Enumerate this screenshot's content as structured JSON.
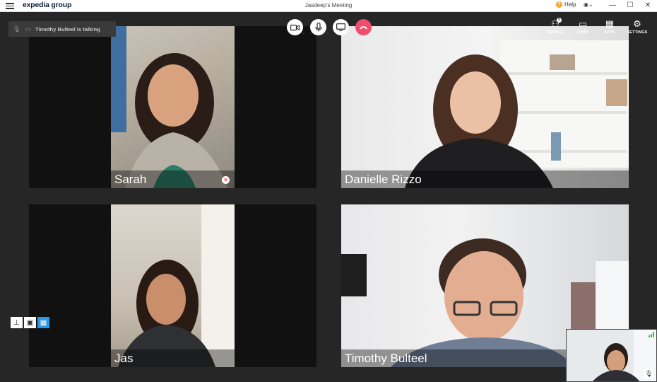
{
  "app": {
    "brand": "expedia group",
    "window_title": "Jasdeep's Meeting",
    "help_label": "Help"
  },
  "window_controls": {
    "minimize": "—",
    "maximize": "☐",
    "close": "✕"
  },
  "status": {
    "talking_text": "Timothy Bulteel is talking"
  },
  "toolbar": {
    "right_items": [
      {
        "label": "PEOPLE",
        "icon": "people-icon",
        "badge": "5"
      },
      {
        "label": "CHAT",
        "icon": "chat-icon"
      },
      {
        "label": "APPS",
        "icon": "apps-icon"
      },
      {
        "label": "SETTINGS",
        "icon": "gear-icon"
      }
    ]
  },
  "participants": [
    {
      "name": "Sarah",
      "muted": true
    },
    {
      "name": "Danielle Rizzo",
      "muted": false
    },
    {
      "name": "Jas",
      "muted": false
    },
    {
      "name": "Timothy Bulteel",
      "muted": false
    }
  ],
  "colors": {
    "accent_blue": "#2f97e8",
    "hangup": "#f04b6a",
    "brand_navy": "#0b1f3a"
  }
}
